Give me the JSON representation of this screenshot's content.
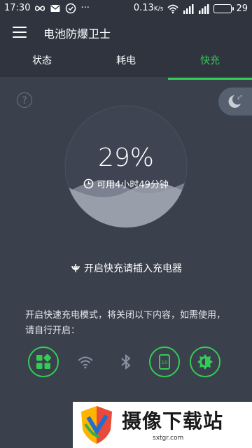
{
  "status_bar": {
    "time": "17:30",
    "speed": "0.13",
    "speed_unit": "K/s",
    "battery": "29"
  },
  "app_bar": {
    "title": "电池防爆卫士"
  },
  "tabs": [
    {
      "label": "状态",
      "active": false
    },
    {
      "label": "耗电",
      "active": false
    },
    {
      "label": "快充",
      "active": true
    }
  ],
  "gauge": {
    "percent_text": "29%",
    "level": 0.29
  },
  "remaining": "可用4小时49分钟",
  "plug_hint": "开启快充请插入充电器",
  "description": "开启快速充电模式，将关闭以下内容，如需使用，请自行开启：",
  "toggles": [
    {
      "name": "apps-icon",
      "active": true
    },
    {
      "name": "wifi-icon",
      "active": false
    },
    {
      "name": "bluetooth-icon",
      "active": false
    },
    {
      "name": "auto-rotate-icon",
      "active": true
    },
    {
      "name": "brightness-icon",
      "active": true
    }
  ],
  "watermark": {
    "text": "摄像下载站",
    "url": "sxtgr.com"
  },
  "colors": {
    "accent": "#33cc55",
    "background": "#3a404c",
    "bar": "#2f343f"
  }
}
